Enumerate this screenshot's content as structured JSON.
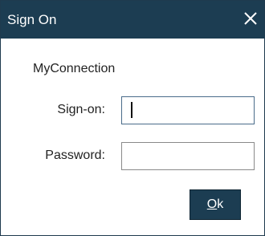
{
  "window": {
    "title": "Sign On",
    "close_glyph": "✕",
    "close_icon": "close-icon"
  },
  "form": {
    "subtitle": "MyConnection",
    "signon_label": "Sign-on:",
    "signon_value": "",
    "password_label": "Password:",
    "password_value": ""
  },
  "actions": {
    "ok_mnemonic": "O",
    "ok_rest": "k"
  },
  "colors": {
    "titlebar": "#1c3d52",
    "button": "#1c3d52",
    "focus_border": "#4a6c8a"
  }
}
